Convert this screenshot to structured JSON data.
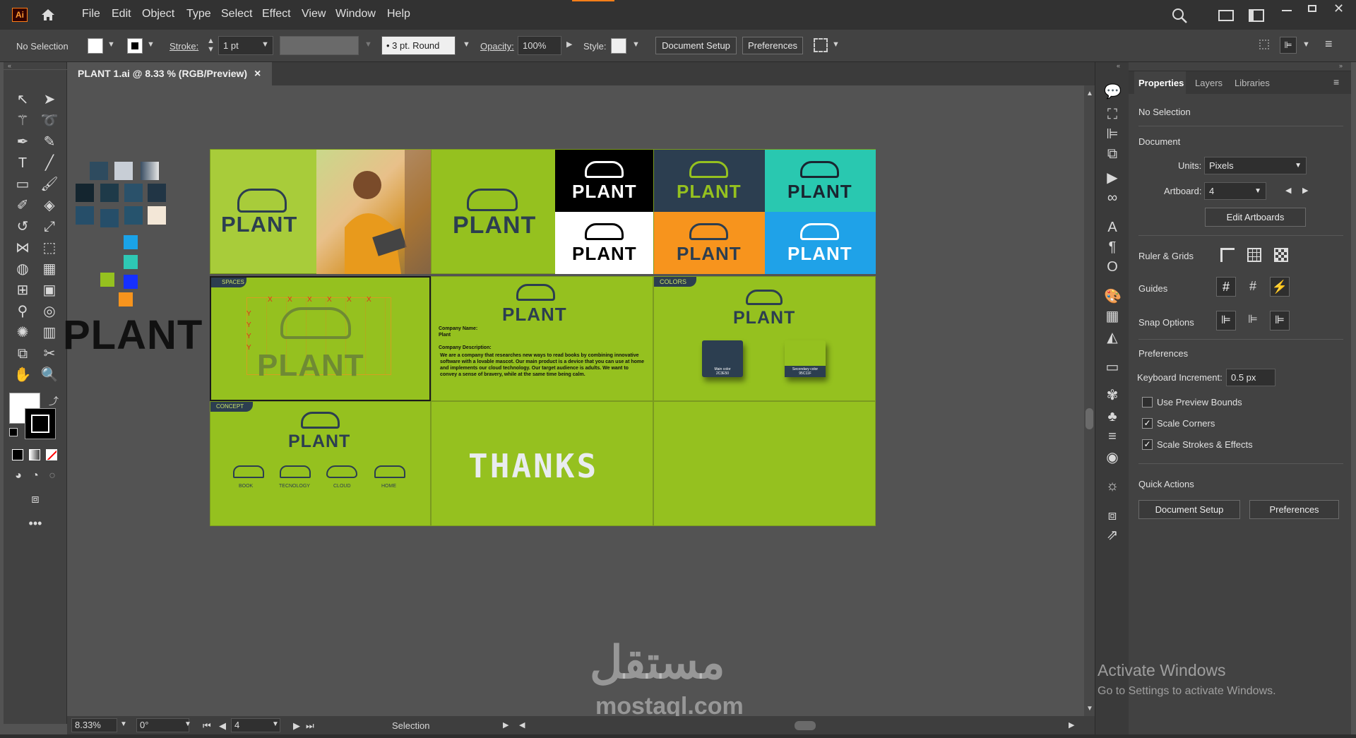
{
  "app": {
    "logo": "Ai",
    "colors": {
      "accent": "#ff7f18",
      "artboard_green": "#95c11f",
      "dark_navy": "#2c3e50",
      "teal": "#29c8b0",
      "orange": "#f7941d",
      "blue": "#1fa2e8"
    }
  },
  "menu": [
    "File",
    "Edit",
    "Object",
    "Type",
    "Select",
    "Effect",
    "View",
    "Window",
    "Help"
  ],
  "control_bar": {
    "selection": "No Selection",
    "stroke_label": "Stroke:",
    "stroke_value": "1 pt",
    "brush": "3 pt. Round",
    "opacity_label": "Opacity:",
    "opacity_value": "100%",
    "style_label": "Style:",
    "document_setup": "Document Setup",
    "preferences": "Preferences"
  },
  "document": {
    "tab_title": "PLANT 1.ai @ 8.33 % (RGB/Preview)",
    "close": "×"
  },
  "artwork": {
    "brand": "PLANT",
    "labels": {
      "spaces": "SPACES",
      "colors": "COLORS",
      "concept": "CONCEPT"
    },
    "company_name_label": "Company Name:",
    "company_name_value": "Plant",
    "company_desc_label": "Company Description:",
    "company_desc": "We are a company that researches new ways to read books by combining innovative software with a lovable mascot. Our main product is a device that you can use at home and implements our cloud technology. Our target audience is adults. We want to convey a sense of bravery, while at the same time being calm.",
    "main_color": "Main color",
    "main_color_hex": "2C3E50",
    "secondary_color": "Secondary color",
    "secondary_color_hex": "95C11F",
    "concept_items": [
      "BOOK",
      "TECNOLOGY",
      "CLOUD",
      "HOME"
    ],
    "thanks": "THANKS",
    "x_marks": "X",
    "y_marks": "Y"
  },
  "status_bar": {
    "zoom": "8.33%",
    "rotation": "0°",
    "artboard": "4",
    "tool": "Selection"
  },
  "panel": {
    "tabs": [
      "Properties",
      "Layers",
      "Libraries"
    ],
    "no_selection": "No Selection",
    "document_heading": "Document",
    "units_label": "Units:",
    "units_value": "Pixels",
    "artboard_label": "Artboard:",
    "artboard_value": "4",
    "edit_artboards": "Edit Artboards",
    "ruler_grids": "Ruler & Grids",
    "guides": "Guides",
    "snap_options": "Snap Options",
    "preferences_heading": "Preferences",
    "keyboard_increment_label": "Keyboard Increment:",
    "keyboard_increment_value": "0.5 px",
    "checkboxes": [
      {
        "label": "Use Preview Bounds",
        "checked": false
      },
      {
        "label": "Scale Corners",
        "checked": true
      },
      {
        "label": "Scale Strokes & Effects",
        "checked": true
      }
    ],
    "quick_actions": "Quick Actions",
    "qa_document_setup": "Document Setup",
    "qa_preferences": "Preferences"
  },
  "watermark": {
    "windows_title": "Activate Windows",
    "windows_sub": "Go to Settings to activate Windows.",
    "site": "mostaql.com",
    "site_ar": "مستقل"
  }
}
